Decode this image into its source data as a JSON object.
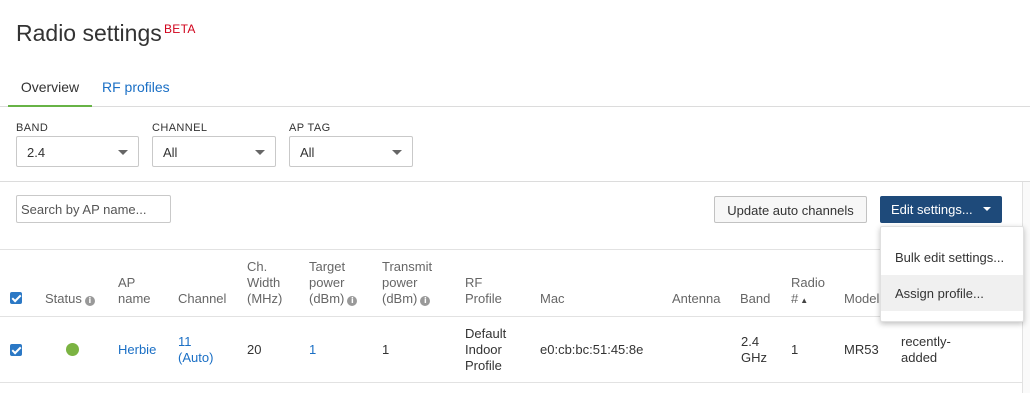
{
  "page": {
    "title": "Radio settings",
    "badge": "BETA"
  },
  "tabs": [
    {
      "label": "Overview",
      "active": true
    },
    {
      "label": "RF profiles",
      "active": false
    }
  ],
  "filters": {
    "band": {
      "label": "BAND",
      "value": "2.4"
    },
    "channel": {
      "label": "CHANNEL",
      "value": "All"
    },
    "ap_tag": {
      "label": "AP TAG",
      "value": "All"
    }
  },
  "toolbar": {
    "search_placeholder": "Search by AP name...",
    "update_label": "Update auto channels",
    "edit_label": "Edit settings..."
  },
  "edit_menu": {
    "items": [
      "Bulk edit settings...",
      "Assign profile..."
    ],
    "highlighted": 1
  },
  "table": {
    "headers": {
      "status": "Status",
      "ap_name_1": "AP",
      "ap_name_2": "name",
      "channel": "Channel",
      "ch_width_1": "Ch.",
      "ch_width_2": "Width",
      "ch_width_3": "(MHz)",
      "target_1": "Target",
      "target_2": "power",
      "target_3": "(dBm)",
      "transmit_1": "Transmit",
      "transmit_2": "power",
      "transmit_3": "(dBm)",
      "rf_1": "RF",
      "rf_2": "Profile",
      "mac": "Mac",
      "antenna": "Antenna",
      "band": "Band",
      "radio_1": "Radio",
      "radio_2": "#",
      "model": "Model"
    },
    "rows": [
      {
        "selected": true,
        "status_color": "#7bb342",
        "ap_name": "Herbie",
        "channel_1": "11",
        "channel_2": "(Auto)",
        "ch_width": "20",
        "target_power": "1",
        "transmit_power": "1",
        "rf_profile_1": "Default",
        "rf_profile_2": "Indoor",
        "rf_profile_3": "Profile",
        "mac": "e0:cb:bc:51:45:8e",
        "antenna": "",
        "band_1": "2.4",
        "band_2": "GHz",
        "radio": "1",
        "model": "MR53",
        "tag_1": "recently-",
        "tag_2": "added"
      }
    ]
  },
  "colors": {
    "accent_green": "#67b346",
    "link_blue": "#1a6fc5",
    "primary_button": "#1e4a7a",
    "beta_red": "#d0021b"
  }
}
